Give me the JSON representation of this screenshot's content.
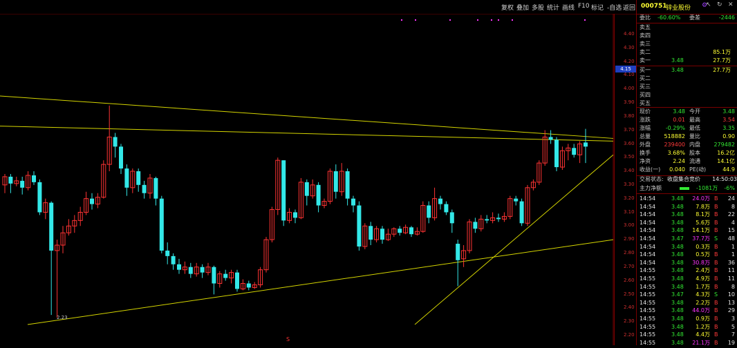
{
  "toolbar": {
    "items": [
      "复权",
      "叠加",
      "多股",
      "统计",
      "画线",
      "F10",
      "标记",
      "-自选",
      "返回"
    ],
    "window_controls": [
      "↖",
      "↻",
      "✕"
    ]
  },
  "price_axis": {
    "ticks": [
      "4.40",
      "4.30",
      "4.20",
      "4.10",
      "4.00",
      "3.90",
      "3.80",
      "3.70",
      "3.60",
      "3.50",
      "3.40",
      "3.30",
      "3.20",
      "3.10",
      "3.00",
      "2.90",
      "2.80",
      "2.70",
      "2.60",
      "2.50",
      "2.40",
      "2.30",
      "2.20"
    ],
    "current": "4.15"
  },
  "chart": {
    "low_label": "2.23",
    "bottom_marker": "S",
    "colors": {
      "up": "#ff3333",
      "down": "#33e8e8",
      "trend": "#d6d600",
      "grid": "#7a0000"
    }
  },
  "stock": {
    "code": "000751",
    "name": "锌业股份",
    "gear_icon": "gear-icon"
  },
  "weibi": {
    "label1": "委比",
    "val1": "-60.60%",
    "label2": "委差",
    "val2": "-2446"
  },
  "sell_orders": [
    {
      "label": "卖五",
      "price": "",
      "vol": ""
    },
    {
      "label": "卖四",
      "price": "",
      "vol": ""
    },
    {
      "label": "卖三",
      "price": "",
      "vol": ""
    },
    {
      "label": "卖二",
      "price": "",
      "vol": "85.1万"
    },
    {
      "label": "卖一",
      "price": "3.48",
      "vol": "27.7万"
    }
  ],
  "buy_orders": [
    {
      "label": "买一",
      "price": "3.48",
      "vol": "27.7万"
    },
    {
      "label": "买二",
      "price": "",
      "vol": ""
    },
    {
      "label": "买三",
      "price": "",
      "vol": ""
    },
    {
      "label": "买四",
      "price": "",
      "vol": ""
    },
    {
      "label": "买五",
      "price": "",
      "vol": ""
    }
  ],
  "quote": [
    {
      "l1": "现价",
      "v1": "3.48",
      "c1": "green",
      "l2": "今开",
      "v2": "3.48",
      "c2": "green"
    },
    {
      "l1": "涨跌",
      "v1": "0.01",
      "c1": "red",
      "l2": "最高",
      "v2": "3.54",
      "c2": "red"
    },
    {
      "l1": "涨幅",
      "v1": "-0.29%",
      "c1": "green",
      "l2": "最低",
      "v2": "3.35",
      "c2": "green"
    },
    {
      "l1": "总量",
      "v1": "518882",
      "c1": "yellow",
      "l2": "量比",
      "v2": "0.90",
      "c2": "yellow"
    },
    {
      "l1": "外盘",
      "v1": "239400",
      "c1": "red",
      "l2": "内盘",
      "v2": "279482",
      "c2": "green"
    },
    {
      "l1": "换手",
      "v1": "3.68%",
      "c1": "yellow",
      "l2": "股本",
      "v2": "16.2亿",
      "c2": "yellow"
    },
    {
      "l1": "净资",
      "v1": "2.24",
      "c1": "yellow",
      "l2": "流通",
      "v2": "14.1亿",
      "c2": "yellow"
    },
    {
      "l1": "收益(一)",
      "v1": "0.040",
      "c1": "yellow",
      "l2": "PE(动)",
      "v2": "44.9",
      "c2": "yellow"
    }
  ],
  "trade_status": {
    "label": "交易状态:",
    "value": "收盘集合竞价",
    "time": "14:50:03"
  },
  "main_net": {
    "label": "主力净额",
    "value": "-1081万",
    "pct": "-6%"
  },
  "ticks": [
    {
      "t": "14:54",
      "p": "3.48",
      "v": "24.0万",
      "v_c": "magenta",
      "bs": "B",
      "n": "24"
    },
    {
      "t": "14:54",
      "p": "3.48",
      "v": "7.8万",
      "v_c": "yellow",
      "bs": "B",
      "n": "8"
    },
    {
      "t": "14:54",
      "p": "3.48",
      "v": "8.1万",
      "v_c": "yellow",
      "bs": "B",
      "n": "22"
    },
    {
      "t": "14:54",
      "p": "3.48",
      "v": "5.6万",
      "v_c": "yellow",
      "bs": "B",
      "n": "4"
    },
    {
      "t": "14:54",
      "p": "3.48",
      "v": "14.1万",
      "v_c": "yellow",
      "bs": "B",
      "n": "15"
    },
    {
      "t": "14:54",
      "p": "3.47",
      "v": "37.7万",
      "v_c": "magenta",
      "bs": "S",
      "n": "48"
    },
    {
      "t": "14:54",
      "p": "3.48",
      "v": "0.3万",
      "v_c": "yellow",
      "bs": "B",
      "n": "1"
    },
    {
      "t": "14:54",
      "p": "3.48",
      "v": "0.5万",
      "v_c": "yellow",
      "bs": "B",
      "n": "1"
    },
    {
      "t": "14:54",
      "p": "3.48",
      "v": "30.8万",
      "v_c": "magenta",
      "bs": "B",
      "n": "36"
    },
    {
      "t": "14:55",
      "p": "3.48",
      "v": "2.4万",
      "v_c": "yellow",
      "bs": "B",
      "n": "11"
    },
    {
      "t": "14:55",
      "p": "3.48",
      "v": "4.9万",
      "v_c": "yellow",
      "bs": "B",
      "n": "11"
    },
    {
      "t": "14:55",
      "p": "3.48",
      "v": "1.7万",
      "v_c": "yellow",
      "bs": "B",
      "n": "8"
    },
    {
      "t": "14:55",
      "p": "3.47",
      "v": "4.3万",
      "v_c": "yellow",
      "bs": "S",
      "n": "10"
    },
    {
      "t": "14:55",
      "p": "3.48",
      "v": "2.2万",
      "v_c": "yellow",
      "bs": "B",
      "n": "13"
    },
    {
      "t": "14:55",
      "p": "3.48",
      "v": "44.0万",
      "v_c": "magenta",
      "bs": "B",
      "n": "29"
    },
    {
      "t": "14:55",
      "p": "3.48",
      "v": "0.9万",
      "v_c": "yellow",
      "bs": "B",
      "n": "3"
    },
    {
      "t": "14:55",
      "p": "3.48",
      "v": "1.2万",
      "v_c": "yellow",
      "bs": "B",
      "n": "5"
    },
    {
      "t": "14:55",
      "p": "3.48",
      "v": "4.4万",
      "v_c": "yellow",
      "bs": "B",
      "n": "7"
    },
    {
      "t": "14:55",
      "p": "3.48",
      "v": "21.1万",
      "v_c": "magenta",
      "bs": "B",
      "n": "19"
    }
  ],
  "candles": [
    {
      "o": 3.2,
      "c": 3.26,
      "h": 3.28,
      "l": 3.14
    },
    {
      "o": 3.26,
      "c": 3.21,
      "h": 3.28,
      "l": 3.14
    },
    {
      "o": 3.21,
      "c": 3.23,
      "h": 3.26,
      "l": 3.19
    },
    {
      "o": 3.23,
      "c": 3.18,
      "h": 3.26,
      "l": 3.13
    },
    {
      "o": 3.18,
      "c": 3.27,
      "h": 3.3,
      "l": 3.16
    },
    {
      "o": 3.27,
      "c": 3.22,
      "h": 3.3,
      "l": 3.2
    },
    {
      "o": 3.22,
      "c": 3.0,
      "h": 3.24,
      "l": 2.98
    },
    {
      "o": 3.0,
      "c": 3.07,
      "h": 3.1,
      "l": 2.95
    },
    {
      "o": 3.07,
      "c": 2.72,
      "h": 3.08,
      "l": 2.25
    },
    {
      "o": 2.72,
      "c": 2.76,
      "h": 2.8,
      "l": 2.23
    },
    {
      "o": 2.76,
      "c": 2.85,
      "h": 2.9,
      "l": 2.7
    },
    {
      "o": 2.85,
      "c": 2.9,
      "h": 2.95,
      "l": 2.83
    },
    {
      "o": 2.9,
      "c": 2.94,
      "h": 2.98,
      "l": 2.85
    },
    {
      "o": 2.94,
      "c": 3.0,
      "h": 3.04,
      "l": 2.9
    },
    {
      "o": 3.0,
      "c": 3.1,
      "h": 3.15,
      "l": 2.98
    },
    {
      "o": 3.1,
      "c": 3.06,
      "h": 3.14,
      "l": 3.02
    },
    {
      "o": 3.06,
      "c": 3.11,
      "h": 3.14,
      "l": 3.03
    },
    {
      "o": 3.11,
      "c": 3.35,
      "h": 3.38,
      "l": 3.1
    },
    {
      "o": 3.35,
      "c": 3.55,
      "h": 3.78,
      "l": 3.3
    },
    {
      "o": 3.55,
      "c": 3.48,
      "h": 3.58,
      "l": 3.4
    },
    {
      "o": 3.48,
      "c": 3.32,
      "h": 3.5,
      "l": 3.28
    },
    {
      "o": 3.32,
      "c": 3.18,
      "h": 3.35,
      "l": 3.12
    },
    {
      "o": 3.18,
      "c": 3.3,
      "h": 3.32,
      "l": 3.14
    },
    {
      "o": 3.3,
      "c": 3.2,
      "h": 3.32,
      "l": 3.15
    },
    {
      "o": 3.2,
      "c": 3.14,
      "h": 3.23,
      "l": 3.1
    },
    {
      "o": 3.14,
      "c": 3.25,
      "h": 3.28,
      "l": 3.1
    },
    {
      "o": 3.25,
      "c": 3.1,
      "h": 3.26,
      "l": 3.05
    },
    {
      "o": 3.1,
      "c": 2.72,
      "h": 3.12,
      "l": 2.7
    },
    {
      "o": 2.72,
      "c": 2.68,
      "h": 2.78,
      "l": 2.62
    },
    {
      "o": 2.68,
      "c": 2.62,
      "h": 2.7,
      "l": 2.58
    },
    {
      "o": 2.62,
      "c": 2.58,
      "h": 2.66,
      "l": 2.55
    },
    {
      "o": 2.58,
      "c": 2.6,
      "h": 2.64,
      "l": 2.55
    },
    {
      "o": 2.6,
      "c": 2.55,
      "h": 2.63,
      "l": 2.52
    },
    {
      "o": 2.55,
      "c": 2.6,
      "h": 2.63,
      "l": 2.53
    },
    {
      "o": 2.6,
      "c": 2.56,
      "h": 2.62,
      "l": 2.52
    },
    {
      "o": 2.56,
      "c": 2.6,
      "h": 2.63,
      "l": 2.54
    },
    {
      "o": 2.6,
      "c": 2.48,
      "h": 2.61,
      "l": 2.4
    },
    {
      "o": 2.48,
      "c": 2.55,
      "h": 2.57,
      "l": 2.45
    },
    {
      "o": 2.55,
      "c": 2.52,
      "h": 2.58,
      "l": 2.5
    },
    {
      "o": 2.52,
      "c": 2.56,
      "h": 2.58,
      "l": 2.48
    },
    {
      "o": 2.56,
      "c": 2.44,
      "h": 2.58,
      "l": 2.42
    },
    {
      "o": 2.44,
      "c": 2.48,
      "h": 2.51,
      "l": 2.43
    },
    {
      "o": 2.48,
      "c": 2.45,
      "h": 2.5,
      "l": 2.43
    },
    {
      "o": 2.45,
      "c": 2.47,
      "h": 2.49,
      "l": 2.44
    },
    {
      "o": 2.47,
      "c": 2.58,
      "h": 2.6,
      "l": 2.45
    },
    {
      "o": 2.58,
      "c": 2.8,
      "h": 2.82,
      "l": 2.56
    },
    {
      "o": 2.8,
      "c": 3.02,
      "h": 3.04,
      "l": 2.78
    },
    {
      "o": 3.02,
      "c": 3.38,
      "h": 3.4,
      "l": 2.98
    },
    {
      "o": 3.38,
      "c": 2.94,
      "h": 3.38,
      "l": 2.9
    },
    {
      "o": 2.94,
      "c": 3.0,
      "h": 3.03,
      "l": 2.92
    },
    {
      "o": 3.0,
      "c": 2.96,
      "h": 3.02,
      "l": 2.92
    },
    {
      "o": 2.96,
      "c": 3.22,
      "h": 3.25,
      "l": 2.95
    },
    {
      "o": 3.22,
      "c": 3.12,
      "h": 3.24,
      "l": 3.05
    },
    {
      "o": 3.12,
      "c": 3.2,
      "h": 3.24,
      "l": 3.1
    },
    {
      "o": 3.2,
      "c": 3.05,
      "h": 3.22,
      "l": 3.0
    },
    {
      "o": 3.05,
      "c": 3.08,
      "h": 3.1,
      "l": 3.03
    },
    {
      "o": 3.08,
      "c": 3.3,
      "h": 3.32,
      "l": 3.06
    },
    {
      "o": 3.3,
      "c": 3.15,
      "h": 3.35,
      "l": 3.1
    },
    {
      "o": 3.15,
      "c": 3.3,
      "h": 3.36,
      "l": 3.12
    },
    {
      "o": 3.3,
      "c": 3.1,
      "h": 3.32,
      "l": 3.05
    },
    {
      "o": 3.1,
      "c": 3.05,
      "h": 3.12,
      "l": 3.0
    },
    {
      "o": 3.05,
      "c": 2.75,
      "h": 3.08,
      "l": 2.72
    },
    {
      "o": 2.75,
      "c": 2.9,
      "h": 2.92,
      "l": 2.73
    },
    {
      "o": 2.9,
      "c": 2.8,
      "h": 2.93,
      "l": 2.76
    },
    {
      "o": 2.8,
      "c": 2.88,
      "h": 2.9,
      "l": 2.78
    },
    {
      "o": 2.88,
      "c": 2.8,
      "h": 2.9,
      "l": 2.77
    },
    {
      "o": 2.8,
      "c": 2.84,
      "h": 2.88,
      "l": 2.79
    },
    {
      "o": 2.84,
      "c": 2.88,
      "h": 2.89,
      "l": 2.82
    },
    {
      "o": 2.88,
      "c": 2.85,
      "h": 2.9,
      "l": 2.83
    },
    {
      "o": 2.85,
      "c": 2.89,
      "h": 2.91,
      "l": 2.84
    },
    {
      "o": 2.89,
      "c": 2.84,
      "h": 2.9,
      "l": 2.82
    },
    {
      "o": 2.84,
      "c": 2.86,
      "h": 2.89,
      "l": 2.83
    },
    {
      "o": 2.86,
      "c": 3.05,
      "h": 3.08,
      "l": 2.85
    },
    {
      "o": 3.05,
      "c": 2.96,
      "h": 3.08,
      "l": 2.92
    },
    {
      "o": 2.96,
      "c": 3.1,
      "h": 3.18,
      "l": 2.94
    },
    {
      "o": 3.1,
      "c": 3.06,
      "h": 3.12,
      "l": 3.02
    },
    {
      "o": 3.06,
      "c": 3.0,
      "h": 3.08,
      "l": 2.98
    },
    {
      "o": 3.0,
      "c": 2.92,
      "h": 3.02,
      "l": 2.85
    },
    {
      "o": 2.77,
      "c": 2.65,
      "h": 2.8,
      "l": 2.46
    },
    {
      "o": 2.66,
      "c": 2.72,
      "h": 2.76,
      "l": 2.6
    },
    {
      "o": 2.72,
      "c": 2.93,
      "h": 2.95,
      "l": 2.7
    },
    {
      "o": 2.93,
      "c": 2.88,
      "h": 2.96,
      "l": 2.85
    },
    {
      "o": 2.88,
      "c": 2.95,
      "h": 2.98,
      "l": 2.86
    },
    {
      "o": 2.95,
      "c": 2.94,
      "h": 2.98,
      "l": 2.92
    },
    {
      "o": 2.94,
      "c": 2.96,
      "h": 3.0,
      "l": 2.92
    },
    {
      "o": 2.96,
      "c": 2.95,
      "h": 2.99,
      "l": 2.93
    },
    {
      "o": 2.95,
      "c": 2.97,
      "h": 3.0,
      "l": 2.93
    },
    {
      "o": 2.97,
      "c": 3.1,
      "h": 3.12,
      "l": 2.95
    },
    {
      "o": 3.1,
      "c": 3.08,
      "h": 3.12,
      "l": 3.05
    },
    {
      "o": 3.08,
      "c": 2.92,
      "h": 3.1,
      "l": 2.9
    },
    {
      "o": 2.92,
      "c": 3.18,
      "h": 3.2,
      "l": 2.9
    },
    {
      "o": 3.18,
      "c": 3.22,
      "h": 3.24,
      "l": 3.16
    },
    {
      "o": 3.22,
      "c": 3.36,
      "h": 3.38,
      "l": 3.2
    },
    {
      "o": 3.36,
      "c": 3.55,
      "h": 3.6,
      "l": 3.34
    },
    {
      "o": 3.55,
      "c": 3.53,
      "h": 3.6,
      "l": 3.5
    },
    {
      "o": 3.53,
      "c": 3.33,
      "h": 3.55,
      "l": 3.3
    },
    {
      "o": 3.33,
      "c": 3.45,
      "h": 3.48,
      "l": 3.31
    },
    {
      "o": 3.45,
      "c": 3.47,
      "h": 3.5,
      "l": 3.38
    },
    {
      "o": 3.47,
      "c": 3.42,
      "h": 3.5,
      "l": 3.4
    },
    {
      "o": 3.42,
      "c": 3.5,
      "h": 3.52,
      "l": 3.36
    },
    {
      "o": 3.51,
      "c": 3.48,
      "h": 3.61,
      "l": 3.36
    }
  ]
}
